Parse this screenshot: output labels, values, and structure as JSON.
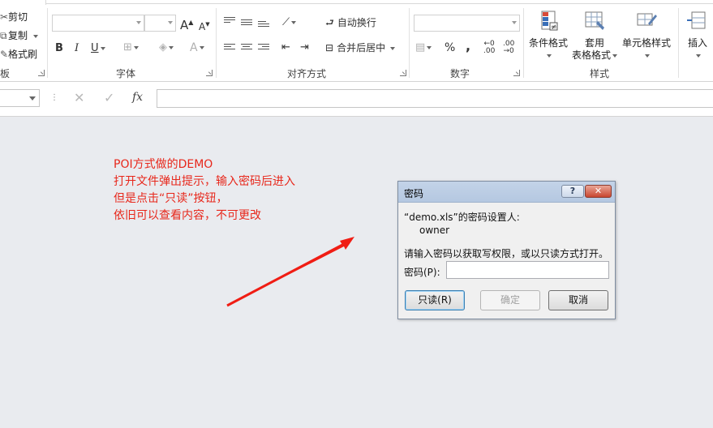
{
  "clipboard": {
    "cut": "剪切",
    "copy": "复制",
    "format_painter": "格式刷",
    "group_label": "板"
  },
  "font": {
    "group_label": "字体",
    "bold": "B",
    "italic": "I",
    "underline": "U",
    "grow": "A",
    "shrink": "A",
    "font_color": "A"
  },
  "alignment": {
    "group_label": "对齐方式",
    "wrap_text": "自动换行",
    "merge_center": "合并后居中"
  },
  "number": {
    "group_label": "数字",
    "percent": "%",
    "comma": ","
  },
  "styles": {
    "group_label": "样式",
    "conditional_format": "条件格式",
    "table_format_line1": "套用",
    "table_format_line2": "表格格式",
    "cell_styles": "单元格样式"
  },
  "cells": {
    "insert": "插入"
  },
  "formula_bar": {
    "fx": "fx",
    "cancel": "✕",
    "enter": "✓"
  },
  "annotation": {
    "line1": "POI方式做的DEMO",
    "line2": "打开文件弹出提示，输入密码后进入",
    "line3": "但是点击“只读”按钮，",
    "line4": "依旧可以查看内容，不可更改",
    "color": "#e8271b"
  },
  "dialog": {
    "title": "密码",
    "help": "?",
    "close": "✕",
    "setter_line": "“demo.xls”的密码设置人:",
    "owner": "owner",
    "prompt": "请输入密码以获取写权限，或以只读方式打开。",
    "password_label": "密码(P):",
    "password_value": "",
    "readonly_button": "只读(R)",
    "ok_button": "确定",
    "cancel_button": "取消"
  }
}
